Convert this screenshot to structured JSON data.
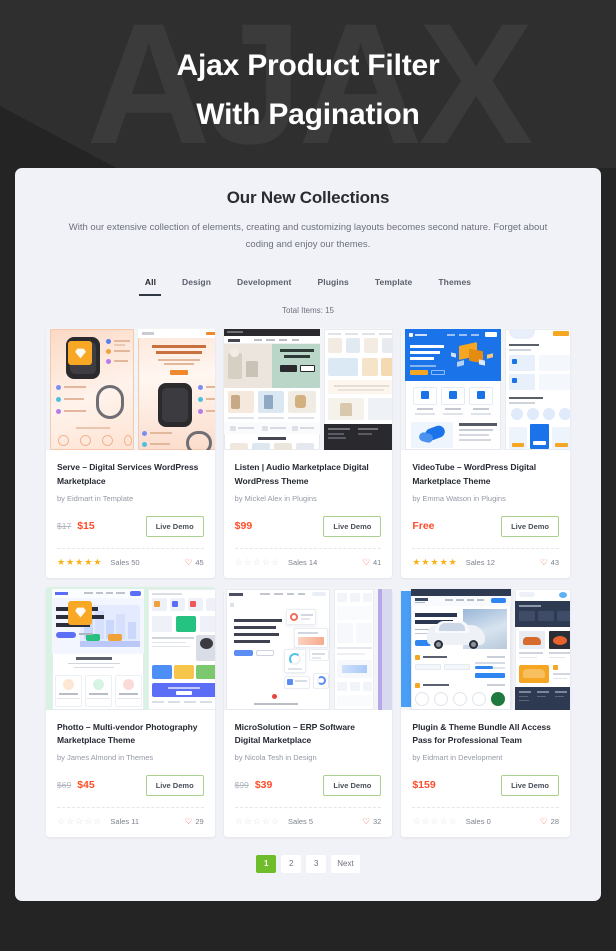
{
  "hero": {
    "watermark": "AJAX",
    "title_line1": "Ajax Product Filter",
    "title_line2": "With Pagination"
  },
  "panel": {
    "title": "Our New Collections",
    "subtitle": "With our extensive collection of elements, creating and customizing layouts becomes second nature. Forget about coding and enjoy our themes.",
    "total_items": "Total Items: 15"
  },
  "tabs": [
    {
      "label": "All",
      "active": true
    },
    {
      "label": "Design",
      "active": false
    },
    {
      "label": "Development",
      "active": false
    },
    {
      "label": "Plugins",
      "active": false
    },
    {
      "label": "Template",
      "active": false
    },
    {
      "label": "Themes",
      "active": false
    }
  ],
  "products": [
    {
      "title": "Serve – Digital Services WordPress Marketplace",
      "author": "by Eidmart in Template",
      "price_old": "$17",
      "price_new": "$15",
      "demo_label": "Live Demo",
      "stars": 5,
      "sales": "Sales 50",
      "likes": "45",
      "badge": "diamond-icon",
      "theme": "watch"
    },
    {
      "title": "Listen | Audio Marketplace Digital WordPress Theme",
      "author": "by Mickel Alex in Plugins",
      "price_old": "",
      "price_new": "$99",
      "demo_label": "Live Demo",
      "stars": 0,
      "sales": "Sales 14",
      "likes": "41",
      "badge": "",
      "theme": "furniture"
    },
    {
      "title": "VideoTube – WordPress Digital Marketplace Theme",
      "author": "by Emma Watson in Plugins",
      "price_old": "",
      "price_new": "Free",
      "demo_label": "Live Demo",
      "stars": 5,
      "sales": "Sales 12",
      "likes": "43",
      "badge": "",
      "theme": "analytics"
    },
    {
      "title": "Photto – Multi-vendor Photography Marketplace Theme",
      "author": "by James Almond in Themes",
      "price_old": "$69",
      "price_new": "$45",
      "demo_label": "Live Demo",
      "stars": 0,
      "sales": "Sales 11",
      "likes": "29",
      "badge": "diamond-icon",
      "theme": "city"
    },
    {
      "title": "MicroSolution – ERP Software Digital Marketplace",
      "author": "by Nicola Tesh in Design",
      "price_old": "$99",
      "price_new": "$39",
      "demo_label": "Live Demo",
      "stars": 0,
      "sales": "Sales 5",
      "likes": "32",
      "badge": "",
      "theme": "dashboard"
    },
    {
      "title": "Plugin & Theme Bundle All Access Pass for Professional Team",
      "author": "by Eidmart in Development",
      "price_old": "",
      "price_new": "$159",
      "demo_label": "Live Demo",
      "stars": 0,
      "sales": "Sales 0",
      "likes": "28",
      "badge": "",
      "theme": "car"
    }
  ],
  "pagination": [
    {
      "label": "1",
      "active": true
    },
    {
      "label": "2",
      "active": false
    },
    {
      "label": "3",
      "active": false
    },
    {
      "label": "Next",
      "active": false
    }
  ],
  "colors": {
    "background": "#242424",
    "hero": "#2f2f2f",
    "watermark": "#3b3b3b",
    "panel": "#f0f2f7",
    "price": "#ff4d29",
    "star": "#fbb016",
    "heart": "#f4553d",
    "pagination_active": "#6fbd2b",
    "demo_border": "#a9d08e",
    "badge": "#f9a825"
  }
}
